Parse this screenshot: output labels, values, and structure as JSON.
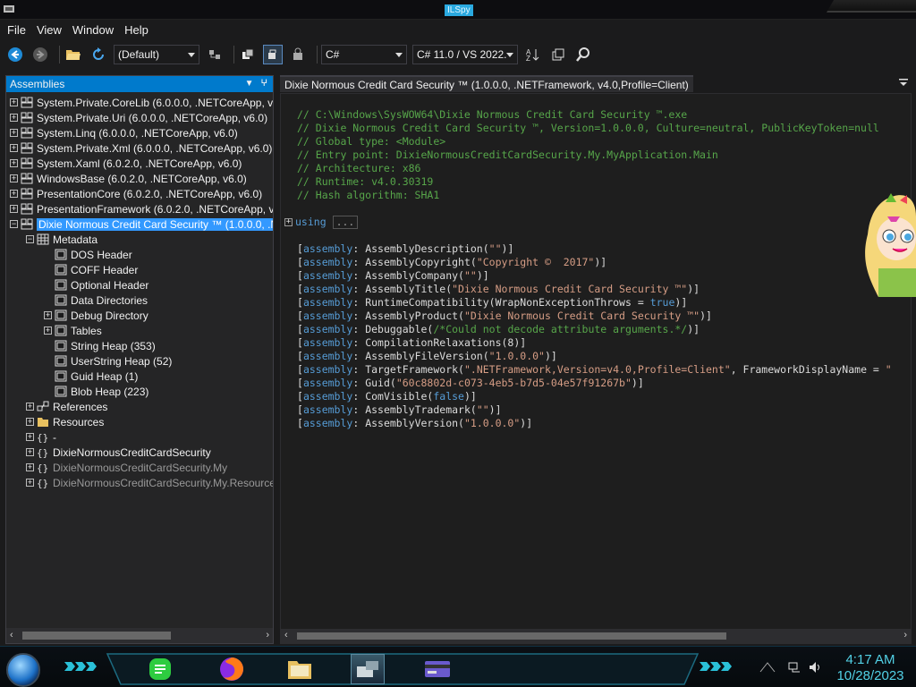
{
  "window": {
    "title": "ILSpy"
  },
  "menu": [
    "File",
    "View",
    "Window",
    "Help"
  ],
  "toolbar": {
    "filter_combo": "(Default)",
    "language_combo": "C#",
    "version_combo": "C# 11.0 / VS 2022.",
    "buttons": [
      "back-icon",
      "forward-icon",
      "open-icon",
      "reload-icon",
      "show-api-icon",
      "show-internal-icon",
      "show-all-icon",
      "decompile-icon",
      "search-icon"
    ]
  },
  "left_panel": {
    "header": "Assemblies",
    "tree": [
      {
        "label": "System.Private.CoreLib (6.0.0.0, .NETCoreApp, v6",
        "level": 0,
        "icon": "assembly",
        "exp": "+"
      },
      {
        "label": "System.Private.Uri (6.0.0.0, .NETCoreApp, v6.0)",
        "level": 0,
        "icon": "assembly",
        "exp": "+"
      },
      {
        "label": "System.Linq (6.0.0.0, .NETCoreApp, v6.0)",
        "level": 0,
        "icon": "assembly",
        "exp": "+"
      },
      {
        "label": "System.Private.Xml (6.0.0.0, .NETCoreApp, v6.0)",
        "level": 0,
        "icon": "assembly",
        "exp": "+"
      },
      {
        "label": "System.Xaml (6.0.2.0, .NETCoreApp, v6.0)",
        "level": 0,
        "icon": "assembly",
        "exp": "+"
      },
      {
        "label": "WindowsBase (6.0.2.0, .NETCoreApp, v6.0)",
        "level": 0,
        "icon": "assembly",
        "exp": "+"
      },
      {
        "label": "PresentationCore (6.0.2.0, .NETCoreApp, v6.0)",
        "level": 0,
        "icon": "assembly",
        "exp": "+"
      },
      {
        "label": "PresentationFramework (6.0.2.0, .NETCoreApp, v",
        "level": 0,
        "icon": "assembly",
        "exp": "+"
      },
      {
        "label": "Dixie Normous Credit Card Security ™ (1.0.0.0, .N",
        "level": 0,
        "icon": "assembly",
        "exp": "-",
        "selected": true
      },
      {
        "label": "Metadata",
        "level": 1,
        "icon": "metadata",
        "exp": "-"
      },
      {
        "label": "DOS Header",
        "level": 2,
        "icon": "table",
        "exp": ""
      },
      {
        "label": "COFF Header",
        "level": 2,
        "icon": "table",
        "exp": ""
      },
      {
        "label": "Optional Header",
        "level": 2,
        "icon": "table",
        "exp": ""
      },
      {
        "label": "Data Directories",
        "level": 2,
        "icon": "table",
        "exp": ""
      },
      {
        "label": "Debug Directory",
        "level": 2,
        "icon": "table",
        "exp": "+"
      },
      {
        "label": "Tables",
        "level": 2,
        "icon": "table",
        "exp": "+"
      },
      {
        "label": "String Heap (353)",
        "level": 2,
        "icon": "table",
        "exp": ""
      },
      {
        "label": "UserString Heap (52)",
        "level": 2,
        "icon": "table",
        "exp": ""
      },
      {
        "label": "Guid Heap (1)",
        "level": 2,
        "icon": "table",
        "exp": ""
      },
      {
        "label": "Blob Heap (223)",
        "level": 2,
        "icon": "table",
        "exp": ""
      },
      {
        "label": "References",
        "level": 1,
        "icon": "references",
        "exp": "+"
      },
      {
        "label": "Resources",
        "level": 1,
        "icon": "folder",
        "exp": "+"
      },
      {
        "label": "-",
        "level": 1,
        "icon": "namespace",
        "exp": "+"
      },
      {
        "label": "DixieNormousCreditCardSecurity",
        "level": 1,
        "icon": "namespace",
        "exp": "+"
      },
      {
        "label": "DixieNormousCreditCardSecurity.My",
        "level": 1,
        "icon": "namespace",
        "exp": "+",
        "gray": true
      },
      {
        "label": "DixieNormousCreditCardSecurity.My.Resource",
        "level": 1,
        "icon": "namespace",
        "exp": "+",
        "gray": true
      }
    ]
  },
  "tab": {
    "label": "Dixie Normous Credit Card Security ™ (1.0.0.0, .NETFramework, v4.0,Profile=Client)"
  },
  "code": {
    "comments": [
      "// C:\\Windows\\SysWOW64\\Dixie Normous Credit Card Security ™.exe",
      "// Dixie Normous Credit Card Security ™, Version=1.0.0.0, Culture=neutral, PublicKeyToken=null",
      "// Global type: <Module>",
      "// Entry point: DixieNormousCreditCardSecurity.My.MyApplication.Main",
      "// Architecture: x86",
      "// Runtime: v4.0.30319",
      "// Hash algorithm: SHA1"
    ],
    "using_keyword": "using",
    "using_box": "...",
    "attributes": [
      [
        {
          "t": "br",
          "v": "["
        },
        {
          "t": "key",
          "v": "assembly"
        },
        {
          "t": "br",
          "v": ": "
        },
        {
          "t": "plain",
          "v": "AssemblyDescription("
        },
        {
          "t": "str",
          "v": "\"\""
        },
        {
          "t": "plain",
          "v": ")]"
        }
      ],
      [
        {
          "t": "br",
          "v": "["
        },
        {
          "t": "key",
          "v": "assembly"
        },
        {
          "t": "br",
          "v": ": "
        },
        {
          "t": "plain",
          "v": "AssemblyCopyright("
        },
        {
          "t": "str",
          "v": "\"Copyright ©  2017\""
        },
        {
          "t": "plain",
          "v": ")]"
        }
      ],
      [
        {
          "t": "br",
          "v": "["
        },
        {
          "t": "key",
          "v": "assembly"
        },
        {
          "t": "br",
          "v": ": "
        },
        {
          "t": "plain",
          "v": "AssemblyCompany("
        },
        {
          "t": "str",
          "v": "\"\""
        },
        {
          "t": "plain",
          "v": ")]"
        }
      ],
      [
        {
          "t": "br",
          "v": "["
        },
        {
          "t": "key",
          "v": "assembly"
        },
        {
          "t": "br",
          "v": ": "
        },
        {
          "t": "plain",
          "v": "AssemblyTitle("
        },
        {
          "t": "str",
          "v": "\"Dixie Normous Credit Card Security ™\""
        },
        {
          "t": "plain",
          "v": ")]"
        }
      ],
      [
        {
          "t": "br",
          "v": "["
        },
        {
          "t": "key",
          "v": "assembly"
        },
        {
          "t": "br",
          "v": ": "
        },
        {
          "t": "plain",
          "v": "RuntimeCompatibility(WrapNonExceptionThrows = "
        },
        {
          "t": "key",
          "v": "true"
        },
        {
          "t": "plain",
          "v": ")]"
        }
      ],
      [
        {
          "t": "br",
          "v": "["
        },
        {
          "t": "key",
          "v": "assembly"
        },
        {
          "t": "br",
          "v": ": "
        },
        {
          "t": "plain",
          "v": "AssemblyProduct("
        },
        {
          "t": "str",
          "v": "\"Dixie Normous Credit Card Security ™\""
        },
        {
          "t": "plain",
          "v": ")]"
        }
      ],
      [
        {
          "t": "br",
          "v": "["
        },
        {
          "t": "key",
          "v": "assembly"
        },
        {
          "t": "br",
          "v": ": "
        },
        {
          "t": "plain",
          "v": "Debuggable("
        },
        {
          "t": "com",
          "v": "/*Could not decode attribute arguments.*/"
        },
        {
          "t": "plain",
          "v": ")]"
        }
      ],
      [
        {
          "t": "br",
          "v": "["
        },
        {
          "t": "key",
          "v": "assembly"
        },
        {
          "t": "br",
          "v": ": "
        },
        {
          "t": "plain",
          "v": "CompilationRelaxations(8)]"
        }
      ],
      [
        {
          "t": "br",
          "v": "["
        },
        {
          "t": "key",
          "v": "assembly"
        },
        {
          "t": "br",
          "v": ": "
        },
        {
          "t": "plain",
          "v": "AssemblyFileVersion("
        },
        {
          "t": "str",
          "v": "\"1.0.0.0\""
        },
        {
          "t": "plain",
          "v": ")]"
        }
      ],
      [
        {
          "t": "br",
          "v": "["
        },
        {
          "t": "key",
          "v": "assembly"
        },
        {
          "t": "br",
          "v": ": "
        },
        {
          "t": "plain",
          "v": "TargetFramework("
        },
        {
          "t": "str",
          "v": "\".NETFramework,Version=v4.0,Profile=Client\""
        },
        {
          "t": "plain",
          "v": ", FrameworkDisplayName = "
        },
        {
          "t": "str",
          "v": "\""
        }
      ],
      [
        {
          "t": "br",
          "v": "["
        },
        {
          "t": "key",
          "v": "assembly"
        },
        {
          "t": "br",
          "v": ": "
        },
        {
          "t": "plain",
          "v": "Guid("
        },
        {
          "t": "str",
          "v": "\"60c8802d-c073-4eb5-b7d5-04e57f91267b\""
        },
        {
          "t": "plain",
          "v": ")]"
        }
      ],
      [
        {
          "t": "br",
          "v": "["
        },
        {
          "t": "key",
          "v": "assembly"
        },
        {
          "t": "br",
          "v": ": "
        },
        {
          "t": "plain",
          "v": "ComVisible("
        },
        {
          "t": "key",
          "v": "false"
        },
        {
          "t": "plain",
          "v": ")]"
        }
      ],
      [
        {
          "t": "br",
          "v": "["
        },
        {
          "t": "key",
          "v": "assembly"
        },
        {
          "t": "br",
          "v": ": "
        },
        {
          "t": "plain",
          "v": "AssemblyTrademark("
        },
        {
          "t": "str",
          "v": "\"\""
        },
        {
          "t": "plain",
          "v": ")]"
        }
      ],
      [
        {
          "t": "br",
          "v": "["
        },
        {
          "t": "key",
          "v": "assembly"
        },
        {
          "t": "br",
          "v": ": "
        },
        {
          "t": "plain",
          "v": "AssemblyVersion("
        },
        {
          "t": "str",
          "v": "\"1.0.0.0\""
        },
        {
          "t": "plain",
          "v": ")]"
        }
      ]
    ]
  },
  "taskbar": {
    "apps": [
      "notes-app-icon",
      "firefox-icon",
      "file-explorer-icon",
      "ilspy-icon",
      "card-app-icon"
    ],
    "tray_icons": [
      "network-icon",
      "volume-icon"
    ],
    "time": "4:17 AM",
    "date": "10/28/2023"
  },
  "colors": {
    "accent": "#007acc",
    "selection": "#3399ff",
    "comment": "#57a64a",
    "keyword": "#569cd6",
    "string": "#d69d85",
    "clock": "#52d1e6"
  }
}
